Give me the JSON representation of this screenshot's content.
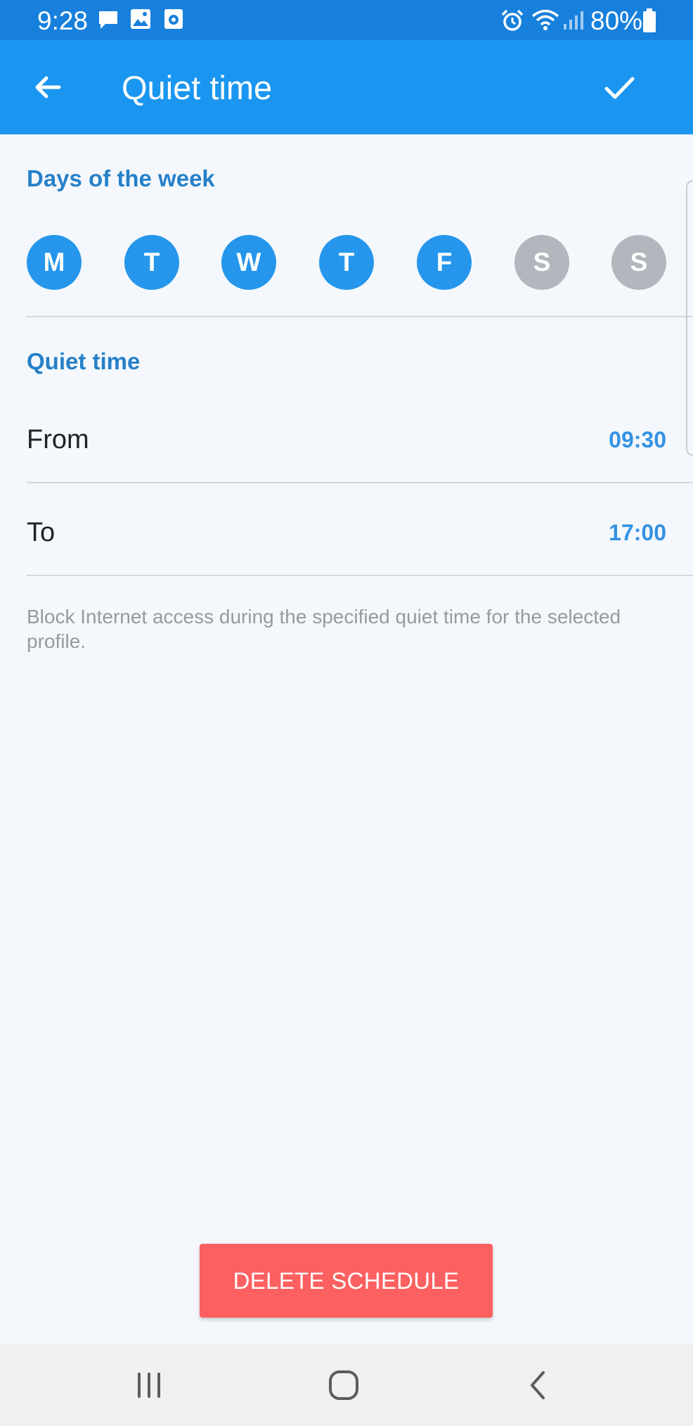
{
  "status_bar": {
    "time": "9:28",
    "battery": "80%",
    "icons": [
      "message-icon",
      "image-icon",
      "screen-record-icon",
      "alarm-icon",
      "wifi-icon",
      "signal-icon",
      "battery-icon"
    ]
  },
  "app_bar": {
    "title": "Quiet time",
    "back_icon": "arrow-left-icon",
    "confirm_icon": "checkmark-icon"
  },
  "days_section": {
    "header": "Days of the week",
    "days": [
      {
        "letter": "M",
        "selected": true
      },
      {
        "letter": "T",
        "selected": true
      },
      {
        "letter": "W",
        "selected": true
      },
      {
        "letter": "T",
        "selected": true
      },
      {
        "letter": "F",
        "selected": true
      },
      {
        "letter": "S",
        "selected": false
      },
      {
        "letter": "S",
        "selected": false
      }
    ]
  },
  "quiet_section": {
    "header": "Quiet time",
    "from_label": "From",
    "from_value": "09:30",
    "to_label": "To",
    "to_value": "17:00",
    "helper": "Block Internet access during the specified quiet time for the selected profile."
  },
  "delete_button": "DELETE SCHEDULE",
  "nav_bar": {
    "icons": [
      "recent-apps-icon",
      "home-icon",
      "back-icon"
    ]
  },
  "colors": {
    "status_bar": "#1780dc",
    "app_bar": "#1a96f0",
    "accent": "#2680c8",
    "day_selected": "#2596eb",
    "day_unselected": "#b2b6bd",
    "time_value": "#3592e2",
    "delete": "#fc6060",
    "background": "#f4f8fc"
  }
}
